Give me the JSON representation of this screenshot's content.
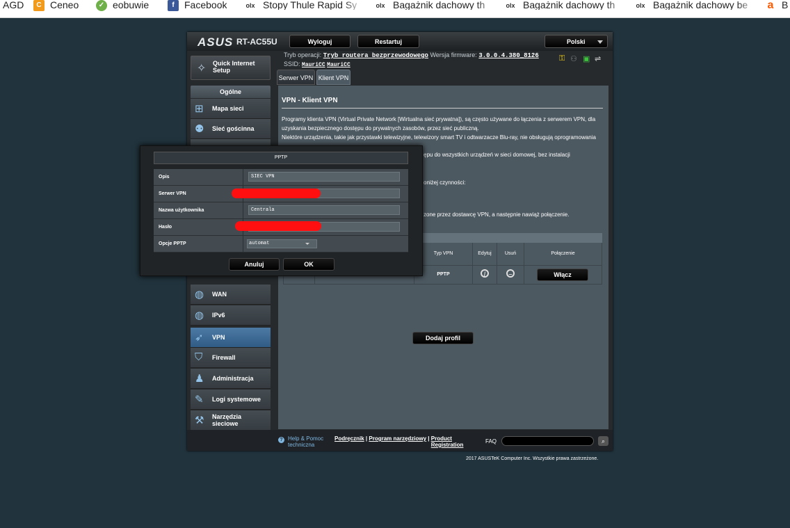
{
  "bookmarks": [
    {
      "label": "AGD",
      "icon": "none"
    },
    {
      "label": "Ceneo",
      "icon": "ceneo-icon",
      "color": "#f29a1b"
    },
    {
      "label": "eobuwie",
      "icon": "eobuwie-icon",
      "color": "#6fb04a"
    },
    {
      "label": "Facebook",
      "icon": "facebook-icon",
      "color": "#3b5998"
    },
    {
      "label": "Stopy Thule Rapid Sy",
      "icon": "olx-icon"
    },
    {
      "label": "Bagażnik dachowy th",
      "icon": "olx-icon"
    },
    {
      "label": "Bagażnik dachowy th",
      "icon": "olx-icon"
    },
    {
      "label": "Bagażnik dachowy be",
      "icon": "olx-icon"
    },
    {
      "label": "B",
      "icon": "allegro-icon",
      "color": "#ff5a00"
    }
  ],
  "router": {
    "brand": "ASUS",
    "model": "RT-AC55U",
    "logout": "Wyloguj",
    "restart": "Restartuj",
    "language": "Polski",
    "op_mode_label": "Tryb operacji:",
    "op_mode_value": "Tryb routera bezprzewodowego",
    "fw_label": "Wersja firmware:",
    "fw_value": "3.0.0.4.380_8126",
    "ssid_label": "SSID:",
    "ssid_1": "MauriCC",
    "ssid_2": "MauriCC"
  },
  "nav": {
    "qis": "Quick Internet Setup",
    "general": "Ogólne",
    "network_map": "Mapa sieci",
    "guest_network": "Sieć gościnna",
    "wan": "WAN",
    "ipv6": "IPv6",
    "vpn": "VPN",
    "firewall": "Firewall",
    "administration": "Administracja",
    "system_log": "Logi systemowe",
    "network_tools": "Narzędzia sieciowe"
  },
  "tabs": {
    "vpn_server": "Serwer VPN",
    "vpn_client": "Klient VPN"
  },
  "content": {
    "title": "VPN - Klient VPN",
    "p1": "Programy klienta VPN (Virtual Private Network [Wirtualna sieć prywatna]), są często używane do łączenia z serwerem VPN, dla",
    "p2": "uzyskania bezpiecznego dostępu do prywatnych zasobów, przez sieć publiczną.",
    "p3": "Niektóre urządzenia, takie jak przystawki telewizyjne, telewizory smart TV i odtwarzacze Blu-ray, nie obsługują oprogramowania",
    "p4": "ępu do wszystkich urządzeń w sieci domowej, bez instalacji",
    "p5": "oniżej czynności:",
    "p6": "zone przez dostawcę VPN, a następnie nawiąż połączenie.",
    "table": {
      "col_type": "Typ VPN",
      "col_edit": "Edytuj",
      "col_delete": "Usuń",
      "col_connection": "Połączenie",
      "row_type": "PPTP",
      "connect_btn": "Włącz"
    },
    "add_profile": "Dodaj profil"
  },
  "footer": {
    "help": "Help & Pomoc techniczna",
    "manual": "Podręcznik",
    "utility": "Program narzędziowy",
    "product_reg": "Product Registration",
    "faq": "FAQ",
    "copyright": "2017 ASUSTeK Computer Inc. Wszystkie prawa zastrzeżone."
  },
  "modal": {
    "title": "PPTP",
    "desc_label": "Opis",
    "desc_value": "SIEC VPN",
    "server_label": "Serwer VPN",
    "server_value": "",
    "user_label": "Nazwa użytkownika",
    "user_value": "Centrala",
    "pass_label": "Hasło",
    "pass_value": "",
    "pptp_opts_label": "Opcje PPTP",
    "pptp_opts_value": "automat",
    "cancel": "Anuluj",
    "ok": "OK"
  }
}
